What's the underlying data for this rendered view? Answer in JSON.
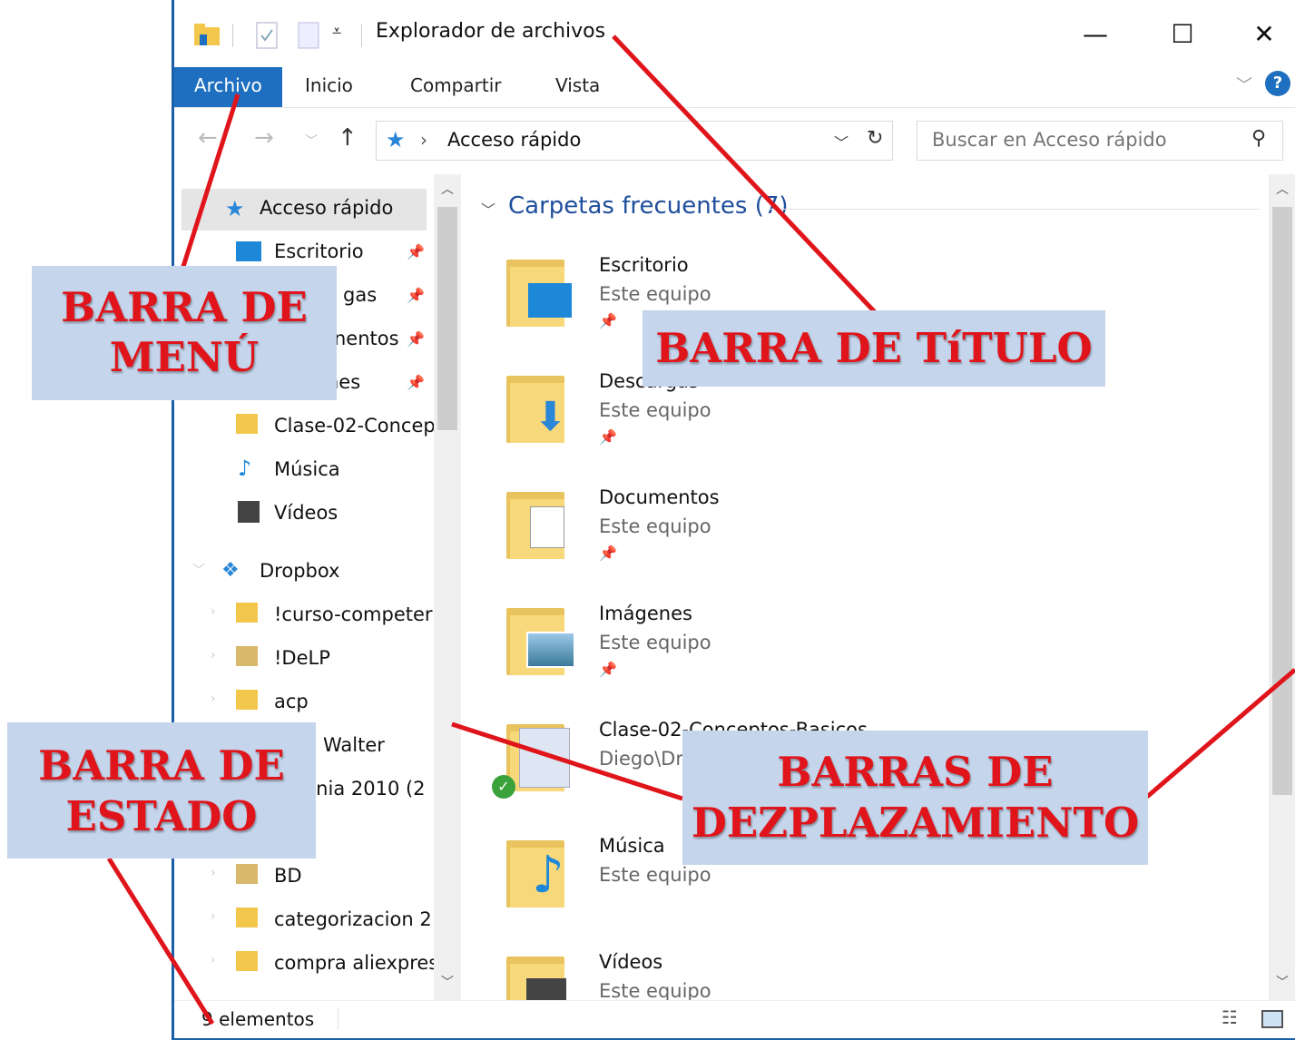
{
  "window": {
    "title": "Explorador de archivos",
    "controls": {
      "minimize": "—",
      "maximize": "☐",
      "close": "✕"
    }
  },
  "ribbon": {
    "tabs": [
      {
        "label": "Archivo",
        "active": true
      },
      {
        "label": "Inicio"
      },
      {
        "label": "Compartir"
      },
      {
        "label": "Vista"
      }
    ]
  },
  "address": {
    "path": "Acceso rápido",
    "search_placeholder": "Buscar en Acceso rápido"
  },
  "navpane": {
    "quick_access": "Acceso rápido",
    "items": [
      {
        "label": "Escritorio",
        "pinned": true
      },
      {
        "label": "gas",
        "pinned": true
      },
      {
        "label": "nentos",
        "pinned": true
      },
      {
        "label": "nes",
        "pinned": true
      },
      {
        "label": "Clase-02-Concep"
      },
      {
        "label": "Música"
      },
      {
        "label": "Vídeos"
      }
    ],
    "dropbox": "Dropbox",
    "dropbox_items": [
      "!curso-competer",
      "!DeLP",
      "acp",
      "Walter",
      "nania 2010 (2",
      "",
      "BD",
      "categorizacion 2",
      "compra aliexpres"
    ]
  },
  "content": {
    "group_title": "Carpetas frecuentes (7)",
    "folders": [
      {
        "name": "Escritorio",
        "location": "Este equipo",
        "pinned": true
      },
      {
        "name": "Descargas",
        "location": "Este equipo",
        "pinned": true
      },
      {
        "name": "Documentos",
        "location": "Este equipo",
        "pinned": true
      },
      {
        "name": "Imágenes",
        "location": "Este equipo",
        "pinned": true
      },
      {
        "name": "Clase-02-Conceptos-Basicos",
        "location": "Diego\\Dr"
      },
      {
        "name": "Música",
        "location": "Este equipo"
      },
      {
        "name": "Vídeos",
        "location": "Este equipo"
      }
    ]
  },
  "status": {
    "items_count": "9 elementos"
  },
  "annotations": {
    "menu": {
      "line1": "BARRA DE",
      "line2": "MENÚ"
    },
    "title": "BARRA DE TíTULO",
    "status": {
      "line1": "BARRA DE",
      "line2": "ESTADO"
    },
    "scroll": {
      "line1": "BARRAS DE",
      "line2": "DEZPLAZAMIENTO"
    }
  },
  "colors": {
    "accent": "#1e6fc0",
    "annotation_text": "#e0151b",
    "annotation_bg": "#c5d5ec",
    "group_title": "#1e4e9c"
  }
}
